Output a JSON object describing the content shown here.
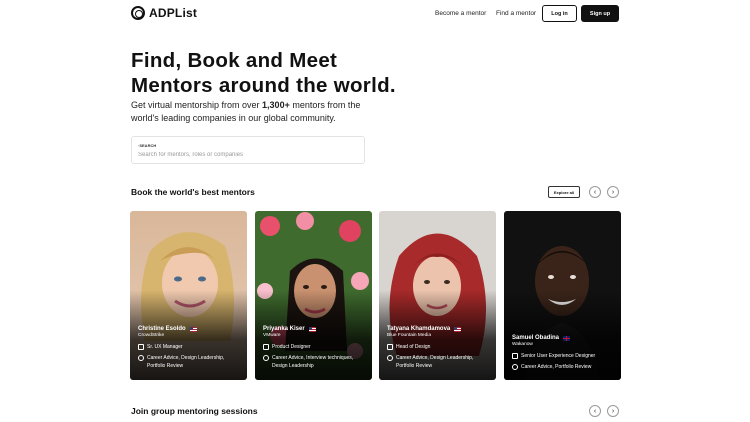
{
  "header": {
    "logo_text": "ADPList",
    "nav": {
      "become_mentor": "Become a mentor",
      "find_mentor": "Find a mentor"
    },
    "login_label": "Log in",
    "signup_label": "Sign up"
  },
  "hero": {
    "title_line1": "Find, Book and Meet",
    "title_line2": "Mentors around the world.",
    "subtitle_before": "Get virtual mentorship from over ",
    "subtitle_count": "1,300+",
    "subtitle_after": " mentors from the world's leading companies in our global community."
  },
  "search": {
    "label": "SEARCH",
    "placeholder": "Search for mentors, roles or companies"
  },
  "mentors_section": {
    "title": "Book the world's best mentors",
    "explore_label": "Explore all",
    "mentors": [
      {
        "name": "Christine Esoldo",
        "flag": "us",
        "company": "CrowdStrike",
        "role": "Sr. UX Manager",
        "topics": "Career Advice, Design Leadership, Portfolio Review"
      },
      {
        "name": "Priyanka Kiser",
        "flag": "us",
        "company": "VMware",
        "role": "Product Designer",
        "topics": "Career Advice, Interview techniques, Design Leadership"
      },
      {
        "name": "Tatyana Khamdamova",
        "flag": "us",
        "company": "Blue Fountain Media",
        "role": "Head of Design",
        "topics": "Career Advice, Design Leadership, Portfolio Review"
      },
      {
        "name": "Samuel Obadina",
        "flag": "uk",
        "company": "Wakanow",
        "role": "Senior User Experience Designer",
        "topics": "Career Advice, Portfolio Review"
      }
    ]
  },
  "group_section": {
    "title": "Join group mentoring sessions"
  },
  "icons": {
    "prev": "chevron-left-icon",
    "next": "chevron-right-icon",
    "role": "briefcase-icon",
    "topics": "chat-icon"
  }
}
